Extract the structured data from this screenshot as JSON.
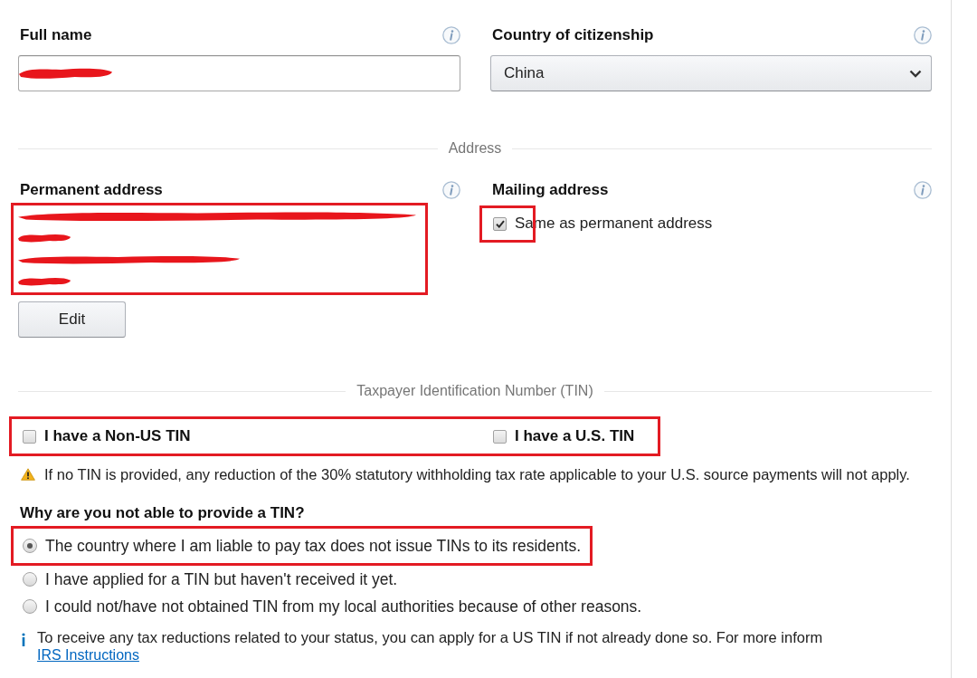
{
  "full_name": {
    "label": "Full name",
    "redacted": true
  },
  "citizenship": {
    "label": "Country of citizenship",
    "value": "China"
  },
  "address_divider": {
    "title": "Address"
  },
  "permanent_address": {
    "label": "Permanent address",
    "highlighted": true,
    "lines": [
      {
        "kind": "long",
        "redacted": true
      },
      {
        "kind": "short",
        "redacted": true
      },
      {
        "kind": "medium",
        "redacted": true
      },
      {
        "kind": "short",
        "redacted": true
      }
    ],
    "edit_button": "Edit"
  },
  "mailing_address": {
    "label": "Mailing address",
    "same_as_permanent": {
      "label": "Same as permanent address",
      "checked": true,
      "highlighted": true
    }
  },
  "tin_divider": {
    "title": "Taxpayer Identification Number (TIN)"
  },
  "tin_options": {
    "highlighted": true,
    "items": [
      {
        "label": "I have a Non-US TIN",
        "checked": false
      },
      {
        "label": "I have a U.S. TIN",
        "checked": false
      }
    ]
  },
  "warning": "If no TIN is provided, any reduction of the 30% statutory withholding tax rate applicable to your U.S. source payments will not apply.",
  "no_tin": {
    "question": "Why are you not able to provide a TIN?",
    "reasons": [
      {
        "label": "The country where I am liable to pay tax does not issue TINs to its residents.",
        "selected": true,
        "highlighted": true
      },
      {
        "label": "I have applied for a TIN but haven't received it yet.",
        "selected": false,
        "highlighted": false
      },
      {
        "label": "I could not/have not obtained TIN from my local authorities because of other reasons.",
        "selected": false,
        "highlighted": false
      }
    ]
  },
  "info_note": {
    "text": "To receive any tax reductions related to your status, you can apply for a US TIN if not already done so. For more inform",
    "link": "IRS Instructions"
  }
}
